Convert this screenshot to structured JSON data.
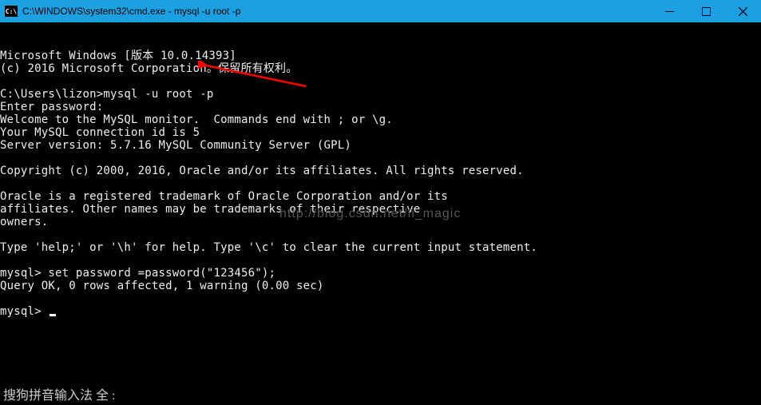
{
  "titlebar": {
    "icon_label": "C:\\",
    "title": "C:\\WINDOWS\\system32\\cmd.exe - mysql  -u root -p"
  },
  "terminal": {
    "lines": [
      "Microsoft Windows [版本 10.0.14393]",
      "(c) 2016 Microsoft Corporation。保留所有权利。",
      "",
      "C:\\Users\\lizon>mysql -u root -p",
      "Enter password:",
      "Welcome to the MySQL monitor.  Commands end with ; or \\g.",
      "Your MySQL connection id is 5",
      "Server version: 5.7.16 MySQL Community Server (GPL)",
      "",
      "Copyright (c) 2000, 2016, Oracle and/or its affiliates. All rights reserved.",
      "",
      "Oracle is a registered trademark of Oracle Corporation and/or its",
      "affiliates. Other names may be trademarks of their respective",
      "owners.",
      "",
      "Type 'help;' or '\\h' for help. Type '\\c' to clear the current input statement.",
      "",
      "mysql> set password =password(\"123456\");",
      "Query OK, 0 rows affected, 1 warning (0.00 sec)",
      "",
      "mysql> "
    ]
  },
  "watermark": {
    "text": "http://blog.csdn.net/li_magic"
  },
  "ime": {
    "text": "搜狗拼音输入法 全 :"
  },
  "arrow": {
    "color": "#ff0000"
  }
}
